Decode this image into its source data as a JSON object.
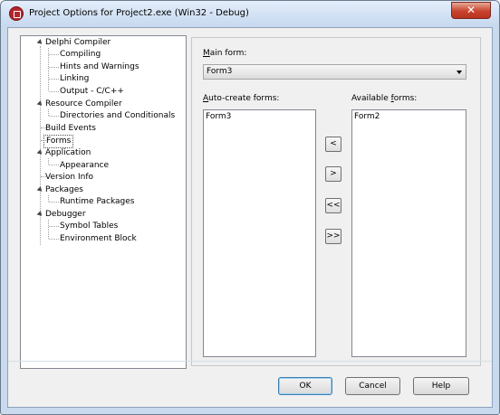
{
  "window": {
    "title": "Project Options for Project2.exe  (Win32 - Debug)",
    "close_symbol": "✕"
  },
  "tree": {
    "items": [
      {
        "label": "Delphi Compiler",
        "level": 0,
        "expanded": true
      },
      {
        "label": "Compiling",
        "level": 1
      },
      {
        "label": "Hints and Warnings",
        "level": 1
      },
      {
        "label": "Linking",
        "level": 1
      },
      {
        "label": "Output - C/C++",
        "level": 1
      },
      {
        "label": "Resource Compiler",
        "level": 0,
        "expanded": true
      },
      {
        "label": "Directories and Conditionals",
        "level": 1
      },
      {
        "label": "Build Events",
        "level": 0
      },
      {
        "label": "Forms",
        "level": 0,
        "selected": true
      },
      {
        "label": "Application",
        "level": 0,
        "expanded": true
      },
      {
        "label": "Appearance",
        "level": 1
      },
      {
        "label": "Version Info",
        "level": 0
      },
      {
        "label": "Packages",
        "level": 0,
        "expanded": true
      },
      {
        "label": "Runtime Packages",
        "level": 1
      },
      {
        "label": "Debugger",
        "level": 0,
        "expanded": true
      },
      {
        "label": "Symbol Tables",
        "level": 1
      },
      {
        "label": "Environment Block",
        "level": 1
      }
    ]
  },
  "forms_page": {
    "main_form_label_accel": "M",
    "main_form_label_rest": "ain form:",
    "main_form_value": "Form3",
    "auto_create_label_accel": "A",
    "auto_create_label_rest": "uto-create forms:",
    "auto_create_items": [
      "Form3"
    ],
    "available_label_pre": "Available ",
    "available_label_accel": "f",
    "available_label_rest": "orms:",
    "available_items": [
      "Form2"
    ],
    "move_buttons": [
      "<",
      ">",
      "<<",
      ">>"
    ]
  },
  "footer": {
    "ok_label": "OK",
    "cancel_label": "Cancel",
    "help_label": "Help"
  },
  "colors": {
    "close_button": "#c8432d",
    "title_bar": "#c6d8ef",
    "dialog_background": "#f0f0f0"
  }
}
